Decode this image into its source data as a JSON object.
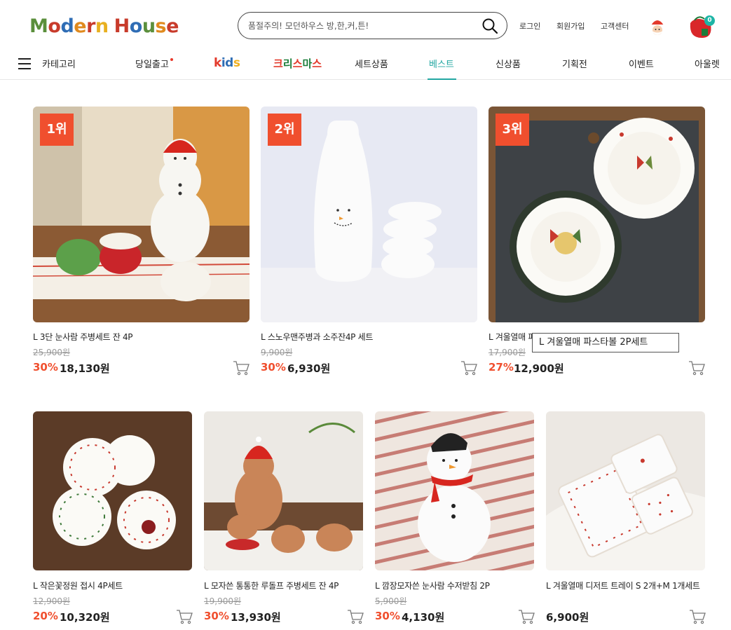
{
  "header": {
    "logo_text": "Modern House",
    "search": {
      "placeholder": "품절주의! 모던하우스 방,한,커,튼!"
    },
    "links": [
      "로그인",
      "회원가입",
      "고객센터"
    ],
    "cart_count": "0"
  },
  "nav": {
    "items": [
      "카테고리",
      "당일출고",
      "kids",
      "크리스마스",
      "세트상품",
      "베스트",
      "신상품",
      "기획전",
      "이벤트",
      "아울렛"
    ],
    "active": "베스트"
  },
  "products": [
    {
      "rank": "1위",
      "name": "L 3단 눈사람 주병세트 잔 4P",
      "original_price": "25,900원",
      "discount": "30%",
      "price": "18,130원"
    },
    {
      "rank": "2위",
      "name": "L 스노우맨주병과 소주잔4P 세트",
      "original_price": "9,900원",
      "discount": "30%",
      "price": "6,930원"
    },
    {
      "rank": "3위",
      "name": "L 겨울열매 파",
      "original_price": "17,900원",
      "discount": "27%",
      "price": "12,900원"
    },
    {
      "name": "L 작은꽃정원 접시 4P세트",
      "original_price": "12,900원",
      "discount": "20%",
      "price": "10,320원"
    },
    {
      "name": "L 모자쓴 통통한 루돌프 주병세트 잔 4P",
      "original_price": "19,900원",
      "discount": "30%",
      "price": "13,930원"
    },
    {
      "name": "L 깜장모자쓴 눈사람 수저받침 2P",
      "original_price": "5,900원",
      "discount": "30%",
      "price": "4,130원"
    },
    {
      "name": "L 겨울열매 디저트 트레이 S 2개+M 1개세트",
      "original_price": "",
      "discount": "",
      "price": "6,900원"
    }
  ],
  "tooltip": "L 겨울열매 파스타볼 2P세트",
  "colors": {
    "accent": "#23a7a2",
    "discount": "#f04f2e",
    "badge": "#1eb5a6"
  }
}
